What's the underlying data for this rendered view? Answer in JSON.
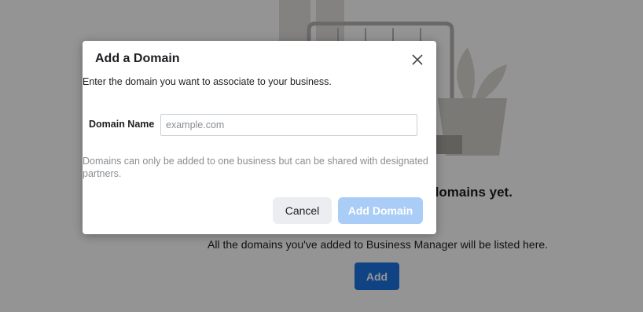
{
  "background": {
    "empty_heading": "domains yet.",
    "empty_text": "All the domains you've added to Business Manager will be listed here.",
    "add_button": "Add"
  },
  "modal": {
    "title": "Add a Domain",
    "close_icon": "close-icon",
    "description": "Enter the domain you want to associate to your business.",
    "field_label": "Domain Name",
    "field_value": "",
    "field_placeholder": "example.com",
    "note": "Domains can only be added to one business but can be shared with designated partners.",
    "cancel_label": "Cancel",
    "submit_label": "Add Domain",
    "submit_enabled": false
  },
  "colors": {
    "primary": "#1b74e4",
    "primary_disabled": "#a9cdf6",
    "secondary_button": "#ebedf0"
  }
}
